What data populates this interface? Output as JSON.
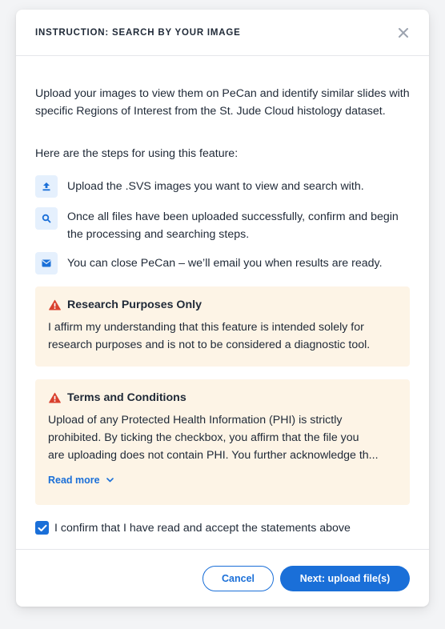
{
  "modal": {
    "title": "INSTRUCTION: SEARCH BY YOUR IMAGE",
    "close_icon": "close-icon"
  },
  "intro": "Upload your images to view them on PeCan and identify similar slides with specific Regions of Interest from the St. Jude Cloud histology dataset.",
  "steps_lead": "Here are the steps for using this feature:",
  "steps": [
    {
      "icon": "upload-icon",
      "text": "Upload the  .SVS images you want to view and search with."
    },
    {
      "icon": "search-icon",
      "text": "Once all files have been uploaded successfully, confirm and begin the processing and searching steps."
    },
    {
      "icon": "mail-icon",
      "text": "You can close PeCan – we’ll email you when results are ready."
    }
  ],
  "research_notice": {
    "icon": "warning-icon",
    "title": "Research Purposes Only",
    "text": "I affirm my understanding that this feature is intended solely for research purposes and is not to be considered a diagnostic tool."
  },
  "terms_notice": {
    "icon": "warning-icon",
    "title": "Terms and Conditions",
    "lines": [
      "Upload of any Protected Health Information (PHI) is strictly",
      "prohibited. By ticking the checkbox, you affirm that the file you",
      "are uploading does not contain PHI. You further acknowledge th..."
    ],
    "read_more": "Read more",
    "read_more_icon": "chevron-down-icon"
  },
  "confirm": {
    "checked": true,
    "label": "I confirm that I have read and accept the statements above"
  },
  "footer": {
    "cancel_label": "Cancel",
    "next_label": "Next: upload file(s)"
  },
  "colors": {
    "accent": "#1a6fd8",
    "notice_bg": "#fdf4e6",
    "warning": "#d9412e",
    "icon_bg": "#e5f0fd"
  }
}
